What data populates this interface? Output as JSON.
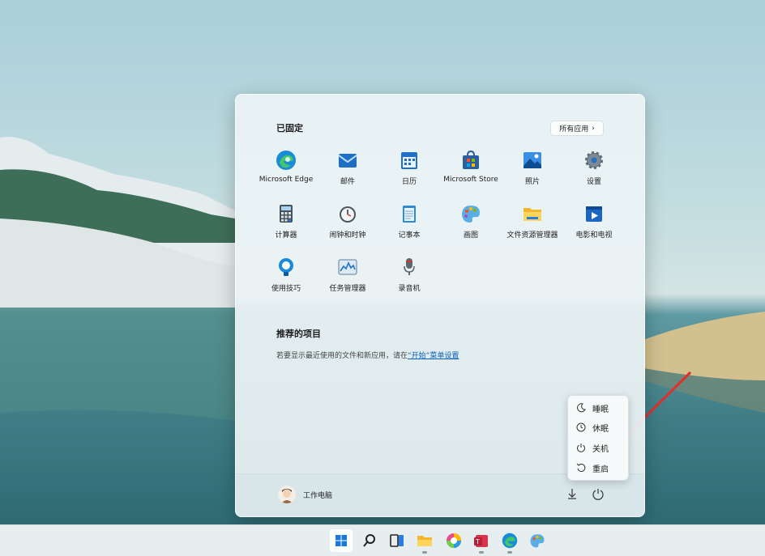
{
  "start_menu": {
    "pinned_title": "已固定",
    "all_apps_label": "所有应用",
    "apps": [
      {
        "label": "Microsoft Edge",
        "icon": "edge-icon"
      },
      {
        "label": "邮件",
        "icon": "mail-icon"
      },
      {
        "label": "日历",
        "icon": "calendar-icon"
      },
      {
        "label": "Microsoft Store",
        "icon": "store-icon"
      },
      {
        "label": "照片",
        "icon": "photos-icon"
      },
      {
        "label": "设置",
        "icon": "gear-icon"
      },
      {
        "label": "计算器",
        "icon": "calculator-icon"
      },
      {
        "label": "闹钟和时钟",
        "icon": "alarm-clock-icon"
      },
      {
        "label": "记事本",
        "icon": "notepad-icon"
      },
      {
        "label": "画图",
        "icon": "paint-icon"
      },
      {
        "label": "文件资源管理器",
        "icon": "folder-icon"
      },
      {
        "label": "电影和电视",
        "icon": "movies-tv-icon"
      },
      {
        "label": "使用技巧",
        "icon": "tips-bulb-icon"
      },
      {
        "label": "任务管理器",
        "icon": "task-manager-icon"
      },
      {
        "label": "录音机",
        "icon": "microphone-icon"
      }
    ],
    "recommended_title": "推荐的项目",
    "recommended_text": "若要显示最近使用的文件和新应用，请在",
    "recommended_link": "“开始”菜单设置",
    "user_name": "工作电脑"
  },
  "power_menu": {
    "items": [
      {
        "label": "睡眠",
        "icon": "sleep-moon-icon"
      },
      {
        "label": "休眠",
        "icon": "hibernate-clock-icon"
      },
      {
        "label": "关机",
        "icon": "power-icon"
      },
      {
        "label": "重启",
        "icon": "restart-icon"
      }
    ]
  },
  "taskbar": {
    "items": [
      "start-icon",
      "search-icon",
      "task-view-icon",
      "file-explorer-icon",
      "photos-app-icon",
      "office-icon",
      "edge-icon",
      "paint-icon"
    ]
  },
  "colors": {
    "accent": "#0a5fb8",
    "arrow": "#e0302a"
  }
}
